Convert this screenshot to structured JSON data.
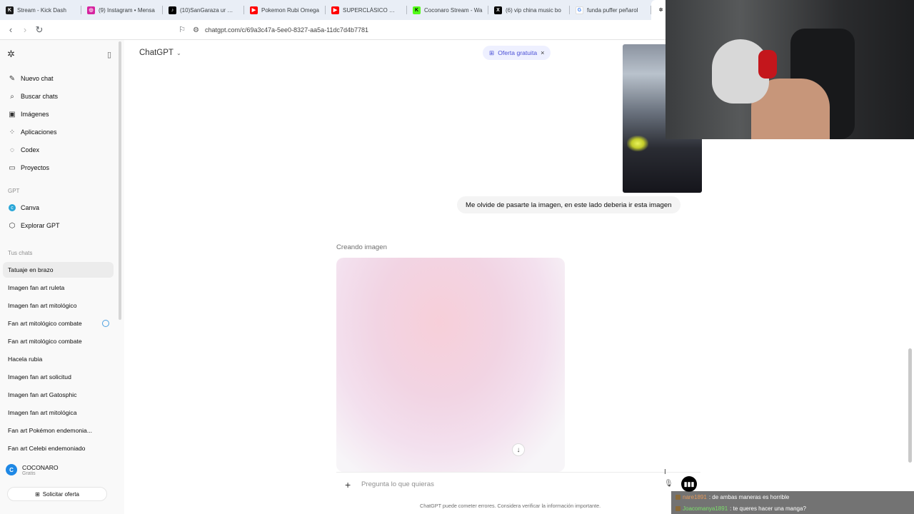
{
  "browser": {
    "tabs": [
      {
        "label": "Stream - Kick Dash",
        "icon": "kick-icon",
        "color": "#1a1a1a"
      },
      {
        "label": "(9) Instagram • Mensa",
        "icon": "instagram-icon",
        "color": "#d6249f"
      },
      {
        "label": "(10)SanGaraza ur 🐯🎮",
        "icon": "tiktok-icon",
        "color": "#000000"
      },
      {
        "label": "Pokemon Rubi Omega",
        "icon": "youtube-icon",
        "color": "#ff0000"
      },
      {
        "label": "SUPERCLÁSICO ⚽ | U",
        "icon": "youtube-icon",
        "color": "#ff0000"
      },
      {
        "label": "Coconaro Stream - Wa",
        "icon": "kick-icon",
        "color": "#53fc18"
      },
      {
        "label": "(6) vip china music bo",
        "icon": "x-icon",
        "color": "#000000"
      },
      {
        "label": "funda puffer peñarol",
        "icon": "google-icon",
        "color": "#4285f4"
      }
    ],
    "url": "chatgpt.com/c/69a3c47a-5ee0-8327-aa5a-11dc7d4b7781"
  },
  "sidebar": {
    "nav": [
      {
        "label": "Nuevo chat",
        "icon": "new-chat-icon"
      },
      {
        "label": "Buscar chats",
        "icon": "search-icon"
      },
      {
        "label": "Imágenes",
        "icon": "images-icon"
      },
      {
        "label": "Aplicaciones",
        "icon": "apps-icon"
      },
      {
        "label": "Codex",
        "icon": "codex-icon"
      },
      {
        "label": "Proyectos",
        "icon": "folder-icon"
      }
    ],
    "gpt_section": "GPT",
    "gpts": [
      {
        "label": "Canva",
        "icon": "canva-icon"
      },
      {
        "label": "Explorar GPT",
        "icon": "explore-icon"
      }
    ],
    "chats_section": "Tus chats",
    "chats": [
      "Tatuaje en brazo",
      "Imagen fan art ruleta",
      "Imagen fan art mitológico",
      "Fan art mitológico combate",
      "Fan art mitológico combate",
      "Hacela rubia",
      "Imagen fan art solicitud",
      "Imagen fan art Gatosphic",
      "Imagen fan art mitológica",
      "Fan art Pokémon endemonia...",
      "Fan art Celebi endemoniado"
    ],
    "user": {
      "initial": "C",
      "name": "COCONARO",
      "plan": "Gratis"
    },
    "offer_button": "Solicitar oferta"
  },
  "main": {
    "model": "ChatGPT",
    "offer_pill": "Oferta gratuita",
    "user_message": "Me olvide de pasarte la imagen, en este lado deberia ir esta imagen",
    "creating_label": "Creando imagen",
    "composer_placeholder": "Pregunta lo que quieras",
    "disclaimer": "ChatGPT puede cometer errores. Considera verificar la información importante."
  },
  "stream_chat": [
    {
      "user": "nare1891",
      "text": ": de ambas maneras es horrible"
    },
    {
      "user": "Joacomanya1891",
      "text": ": te queres hacer una manga?"
    }
  ]
}
